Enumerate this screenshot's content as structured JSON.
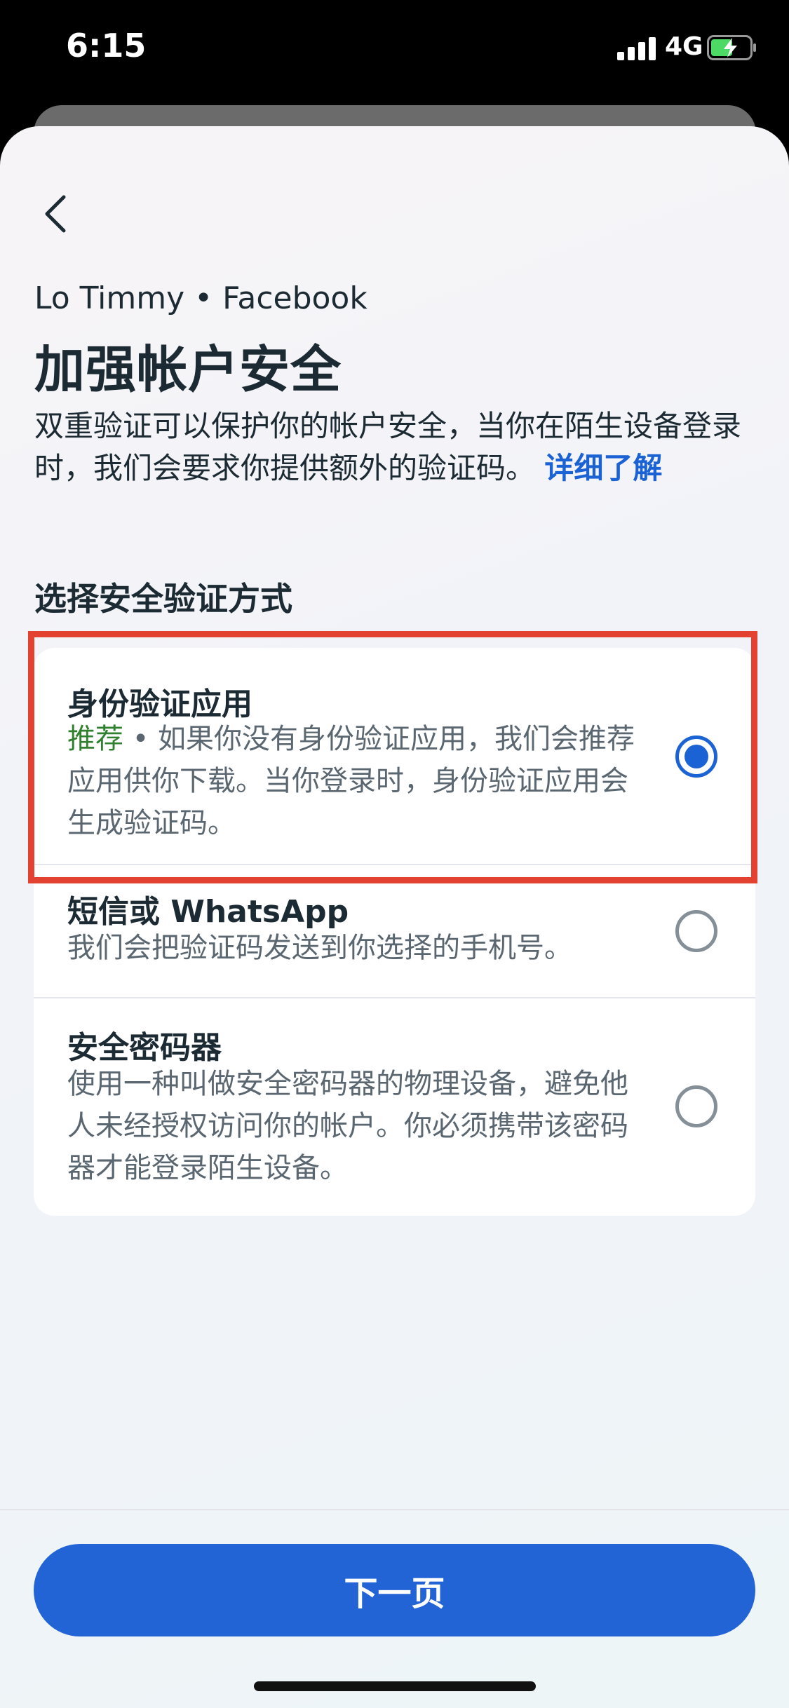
{
  "status_bar": {
    "time": "6:15",
    "network": "4G",
    "icons": [
      "signal-icon",
      "battery-charging-icon"
    ]
  },
  "header": {
    "back_icon": "chevron-left-icon",
    "account": "Lo Timmy • Facebook",
    "title": "加强帐户安全",
    "intro": "双重验证可以保护你的帐户安全，当你在陌生设备登录时，我们会要求你提供额外的验证码。",
    "learn_more": "详细了解"
  },
  "section": {
    "heading": "选择安全验证方式"
  },
  "options": [
    {
      "title": "身份验证应用",
      "tag": "推荐",
      "separator": " • ",
      "description": "如果你没有身份验证应用，我们会推荐应用供你下载。当你登录时，身份验证应用会生成验证码。",
      "selected": true
    },
    {
      "title": "短信或 WhatsApp",
      "description": "我们会把验证码发送到你选择的手机号。",
      "selected": false
    },
    {
      "title": "安全密码器",
      "description": "使用一种叫做安全密码器的物理设备，避免他人未经授权访问你的帐户。你必须携带该密码器才能登录陌生设备。",
      "selected": false
    }
  ],
  "footer": {
    "next_label": "下一页"
  },
  "colors": {
    "primary": "#2263d6",
    "recommended": "#31802f",
    "highlight": "#e2422f",
    "text": "#1c2b33",
    "secondary_text": "#5b6770"
  }
}
